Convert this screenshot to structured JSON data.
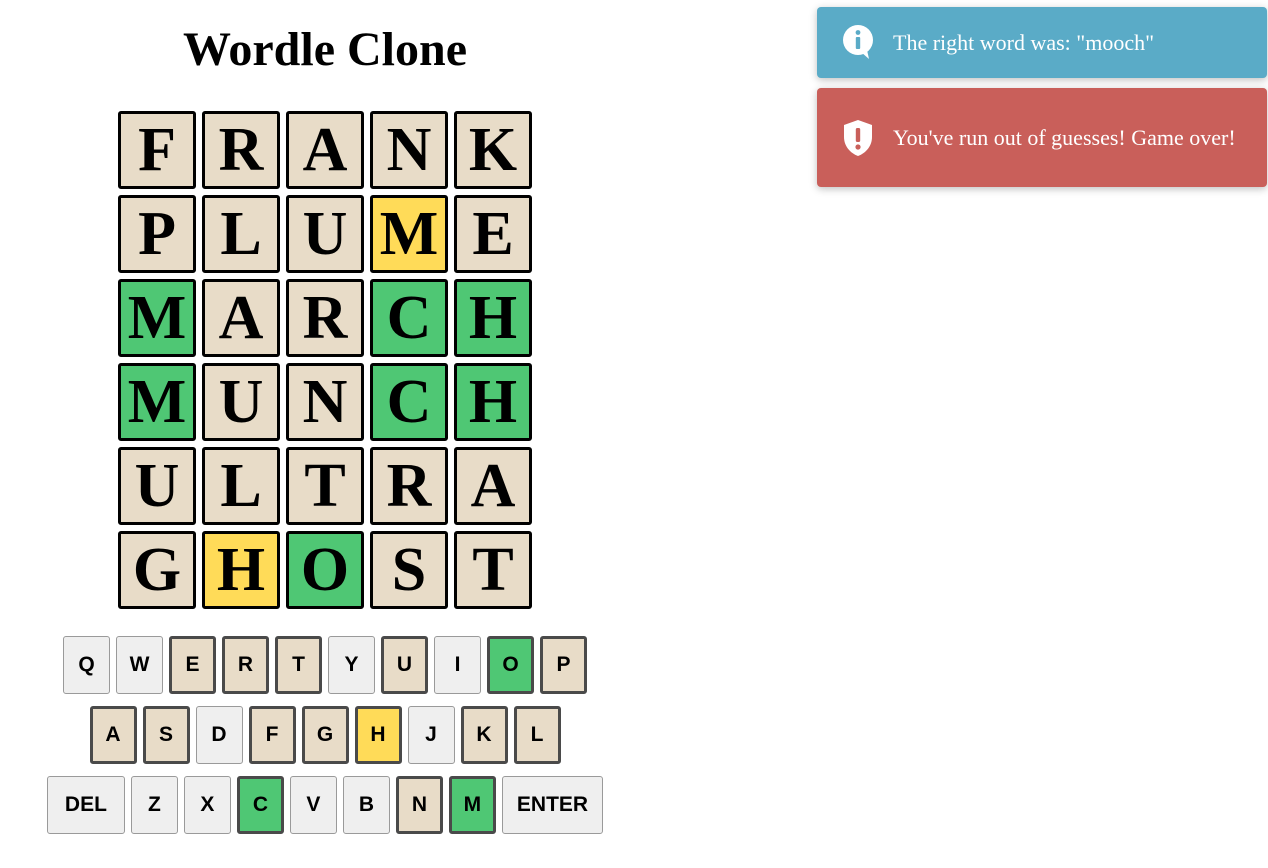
{
  "title": "Wordle Clone",
  "colors": {
    "absent": "#e8dcc8",
    "present": "#ffdb58",
    "correct": "#4fc774",
    "unused": "#efefef",
    "info": "#5aabc7",
    "error": "#c95f5a"
  },
  "board": [
    [
      {
        "letter": "F",
        "state": "absent"
      },
      {
        "letter": "R",
        "state": "absent"
      },
      {
        "letter": "A",
        "state": "absent"
      },
      {
        "letter": "N",
        "state": "absent"
      },
      {
        "letter": "K",
        "state": "absent"
      }
    ],
    [
      {
        "letter": "P",
        "state": "absent"
      },
      {
        "letter": "L",
        "state": "absent"
      },
      {
        "letter": "U",
        "state": "absent"
      },
      {
        "letter": "M",
        "state": "present"
      },
      {
        "letter": "E",
        "state": "absent"
      }
    ],
    [
      {
        "letter": "M",
        "state": "correct"
      },
      {
        "letter": "A",
        "state": "absent"
      },
      {
        "letter": "R",
        "state": "absent"
      },
      {
        "letter": "C",
        "state": "correct"
      },
      {
        "letter": "H",
        "state": "correct"
      }
    ],
    [
      {
        "letter": "M",
        "state": "correct"
      },
      {
        "letter": "U",
        "state": "absent"
      },
      {
        "letter": "N",
        "state": "absent"
      },
      {
        "letter": "C",
        "state": "correct"
      },
      {
        "letter": "H",
        "state": "correct"
      }
    ],
    [
      {
        "letter": "U",
        "state": "absent"
      },
      {
        "letter": "L",
        "state": "absent"
      },
      {
        "letter": "T",
        "state": "absent"
      },
      {
        "letter": "R",
        "state": "absent"
      },
      {
        "letter": "A",
        "state": "absent"
      }
    ],
    [
      {
        "letter": "G",
        "state": "absent"
      },
      {
        "letter": "H",
        "state": "present"
      },
      {
        "letter": "O",
        "state": "correct"
      },
      {
        "letter": "S",
        "state": "absent"
      },
      {
        "letter": "T",
        "state": "absent"
      }
    ]
  ],
  "keyboard": [
    [
      {
        "label": "Q",
        "state": "unused"
      },
      {
        "label": "W",
        "state": "unused"
      },
      {
        "label": "E",
        "state": "absent"
      },
      {
        "label": "R",
        "state": "absent"
      },
      {
        "label": "T",
        "state": "absent"
      },
      {
        "label": "Y",
        "state": "unused"
      },
      {
        "label": "U",
        "state": "absent"
      },
      {
        "label": "I",
        "state": "unused"
      },
      {
        "label": "O",
        "state": "correct"
      },
      {
        "label": "P",
        "state": "absent"
      }
    ],
    [
      {
        "label": "A",
        "state": "absent"
      },
      {
        "label": "S",
        "state": "absent"
      },
      {
        "label": "D",
        "state": "unused"
      },
      {
        "label": "F",
        "state": "absent"
      },
      {
        "label": "G",
        "state": "absent"
      },
      {
        "label": "H",
        "state": "present"
      },
      {
        "label": "J",
        "state": "unused"
      },
      {
        "label": "K",
        "state": "absent"
      },
      {
        "label": "L",
        "state": "absent"
      }
    ],
    [
      {
        "label": "DEL",
        "state": "unused",
        "wide": true
      },
      {
        "label": "Z",
        "state": "unused"
      },
      {
        "label": "X",
        "state": "unused"
      },
      {
        "label": "C",
        "state": "correct"
      },
      {
        "label": "V",
        "state": "unused"
      },
      {
        "label": "B",
        "state": "unused"
      },
      {
        "label": "N",
        "state": "absent"
      },
      {
        "label": "M",
        "state": "correct"
      },
      {
        "label": "ENTER",
        "state": "unused",
        "wide": true
      }
    ]
  ],
  "toasts": {
    "info": {
      "icon": "info-icon",
      "message": "The right word was: \"mooch\""
    },
    "error": {
      "icon": "shield-alert-icon",
      "message": "You've run out of guesses! Game over!"
    }
  }
}
